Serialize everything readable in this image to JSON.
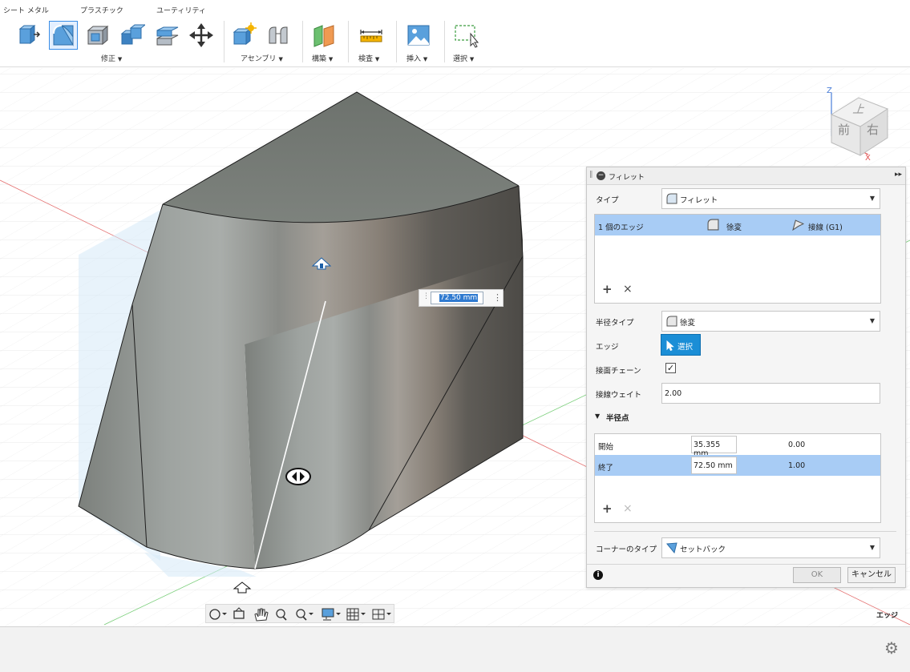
{
  "toolbar": {
    "tabs": [
      "シート メタル",
      "プラスチック",
      "ユーティリティ"
    ],
    "groups": {
      "modify": "修正",
      "assemble": "アセンブリ",
      "construct": "構築",
      "inspect": "検査",
      "insert": "挿入",
      "select": "選択"
    },
    "dropdown_glyph": "▼"
  },
  "viewport": {
    "dimension_value": "72.50 mm",
    "viewcube": {
      "top": "上",
      "front": "前",
      "right": "右",
      "axis_x": "X",
      "axis_z": "Z"
    },
    "colors": {
      "grid": "#e6e6e6",
      "axis_x": "#e57373",
      "axis_y": "#7ccf7c",
      "body": "#8e918c"
    }
  },
  "panel": {
    "title": "フィレット",
    "type_label": "タイプ",
    "type_value": "フィレット",
    "edge_row": {
      "count": "1 個のエッジ",
      "radius": "徐変",
      "continuity": "接線 (G1)"
    },
    "add_glyph": "+",
    "remove_glyph": "×",
    "radius_type_label": "半径タイプ",
    "radius_type_value": "徐変",
    "edge_label": "エッジ",
    "select_button": "選択",
    "tangent_chain_label": "接面チェーン",
    "tangent_chain_checked": true,
    "tangent_weight_label": "接線ウェイト",
    "tangent_weight_value": "2.00",
    "radius_points_label": "半径点",
    "radius_points": [
      {
        "name": "開始",
        "value": "35.355 mm",
        "position": "0.00"
      },
      {
        "name": "終了",
        "value": "72.50 mm",
        "position": "1.00"
      }
    ],
    "corner_type_label": "コーナーのタイプ",
    "corner_type_value": "セットバック",
    "ok": "OK",
    "cancel": "キャンセル"
  },
  "status": {
    "selection_hint": "エッジ"
  }
}
